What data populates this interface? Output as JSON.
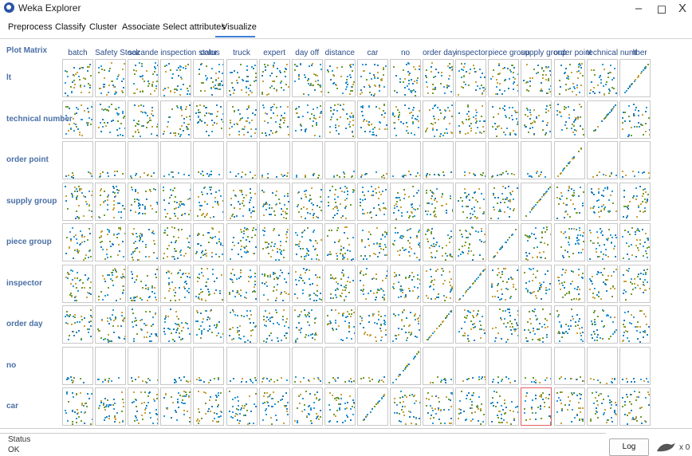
{
  "window": {
    "title": "Weka Explorer",
    "minimize": "–",
    "maximize": "◻",
    "close": "X"
  },
  "tabs": [
    "Preprocess",
    "Classify",
    "Cluster",
    "Associate",
    "Select attributes",
    "Visualize"
  ],
  "active_tab": "Visualize",
  "plot_matrix": {
    "label": "Plot Matrix",
    "columns": [
      "batch",
      "Safety Stock",
      "sazande",
      "inspection status",
      "color",
      "truck",
      "expert",
      "day off",
      "distance",
      "car",
      "no",
      "order day",
      "inspector",
      "piece group",
      "supply group",
      "order point",
      "technical number",
      "lt"
    ],
    "rows": [
      "lt",
      "technical number",
      "order point",
      "supply group",
      "piece group",
      "inspector",
      "order day",
      "no",
      "car"
    ],
    "dot_colors": [
      "#2b9ad6",
      "#1f7fb8",
      "#6f9b2e",
      "#c7a13a"
    ],
    "selected_cell": {
      "row": "car",
      "column": "supply group"
    }
  },
  "status": {
    "title": "Status",
    "text": "OK"
  },
  "log_button": "Log",
  "x_count": "x 0"
}
